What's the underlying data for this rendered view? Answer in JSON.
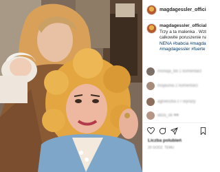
{
  "post": {
    "username": "magdagessler_official",
    "verified": true,
    "caption": {
      "username": "magdagessler_official",
      "lines": [
        "Trzy a ta malenka . Wzbu",
        "calkowite poruszenie na",
        "NENA #babcia #magda",
        "#magdagessler #fuerte"
      ]
    },
    "comments": [
      {
        "avatar_color": "#7b6f66",
        "text": "moniqa_bd 1 komentarz"
      },
      {
        "avatar_color": "#a58b7a",
        "text": "mojaunia 2 komentarz"
      },
      {
        "avatar_color": "#8c6e5c",
        "text": "agnieszka z r wyrazy"
      },
      {
        "avatar_color": "#b59583",
        "text": "aliza_ok ♥♥"
      }
    ],
    "likes_text": "Liczba polubień",
    "timestamp_text": "20 GODZ. TEMU",
    "actions": [
      "heart-icon",
      "comment-icon",
      "share-icon",
      "bookmark-icon"
    ]
  }
}
